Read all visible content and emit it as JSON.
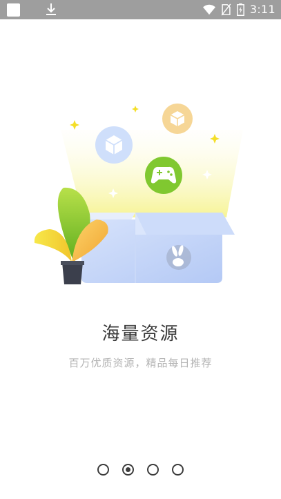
{
  "status_bar": {
    "time": "3:11",
    "icons": [
      "app-notification-icon",
      "download-icon",
      "wifi-icon",
      "no-sim-icon",
      "battery-charging-icon"
    ]
  },
  "onboarding": {
    "title": "海量资源",
    "subtitle": "百万优质资源，精品每日推荐",
    "illustration_icons": [
      "cube-icon",
      "cube-icon",
      "gamepad-icon",
      "rabbit-icon",
      "plant-icon",
      "sparkle-icon"
    ]
  },
  "pager": {
    "page_count": 4,
    "current_page": 2
  },
  "colors": {
    "status_bar": "#9e9e9e",
    "box_blue": "#bcd0f7",
    "game_green": "#7cc52a",
    "cube_orange": "#f3c97c",
    "light_yellow": "#f7f49a"
  }
}
